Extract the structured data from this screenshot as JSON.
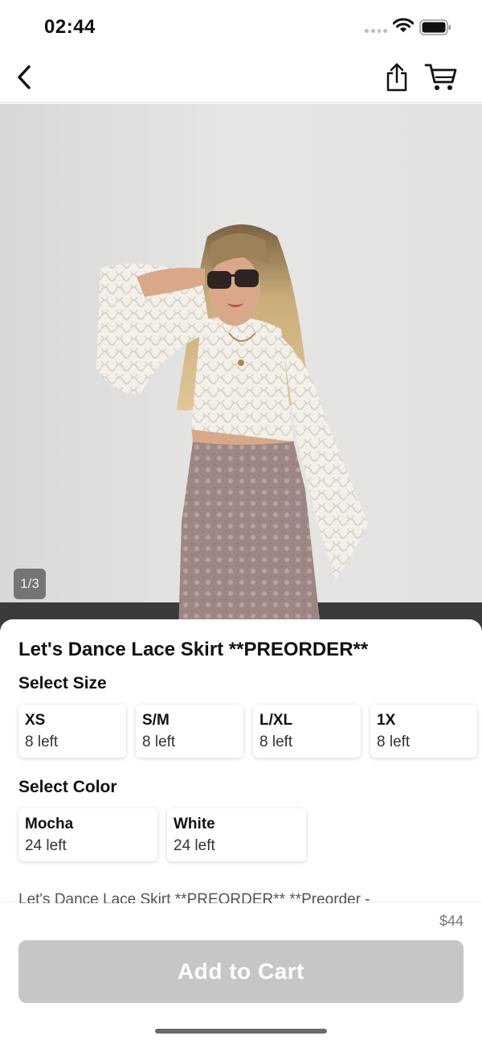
{
  "status_bar": {
    "time": "02:44"
  },
  "nav": {
    "back_icon": "chevron-left-icon",
    "share_icon": "share-icon",
    "cart_icon": "cart-icon"
  },
  "gallery": {
    "counter": "1/3",
    "current_index": 1,
    "total": 3
  },
  "product": {
    "title": "Let's Dance Lace Skirt **PREORDER**",
    "description": "Let's Dance Lace Skirt **PREORDER**  **Preorder -",
    "price": "$44"
  },
  "size_section": {
    "label": "Select Size",
    "options": [
      {
        "name": "XS",
        "stock": "8 left"
      },
      {
        "name": "S/M",
        "stock": "8 left"
      },
      {
        "name": "L/XL",
        "stock": "8 left"
      },
      {
        "name": "1X",
        "stock": "8 left"
      }
    ]
  },
  "color_section": {
    "label": "Select Color",
    "options": [
      {
        "name": "Mocha",
        "stock": "24 left"
      },
      {
        "name": "White",
        "stock": "24 left"
      }
    ]
  },
  "cta": {
    "label": "Add to Cart",
    "enabled": false,
    "color": "#c6c6c6"
  }
}
